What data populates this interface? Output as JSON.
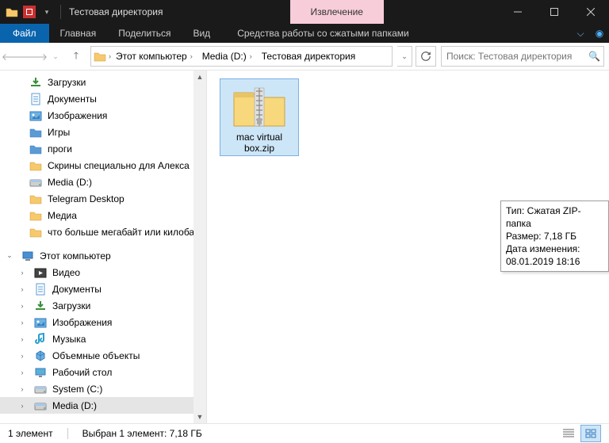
{
  "title": "Тестовая директория",
  "context_tab": "Извлечение",
  "ribbon": {
    "file": "Файл",
    "tabs": [
      "Главная",
      "Поделиться",
      "Вид"
    ],
    "context": "Средства работы со сжатыми папками"
  },
  "breadcrumb": [
    "Этот компьютер",
    "Media (D:)",
    "Тестовая директория"
  ],
  "search_placeholder": "Поиск: Тестовая директория",
  "tree": {
    "group1": [
      {
        "label": "Загрузки",
        "icon": "download"
      },
      {
        "label": "Документы",
        "icon": "doc"
      },
      {
        "label": "Изображения",
        "icon": "images"
      },
      {
        "label": "Игры",
        "icon": "folder-blue"
      },
      {
        "label": "проги",
        "icon": "folder-blue"
      },
      {
        "label": "Скрины специально для Алекса",
        "icon": "folder"
      },
      {
        "label": "Media (D:)",
        "icon": "drive"
      },
      {
        "label": "Telegram Desktop",
        "icon": "folder"
      },
      {
        "label": "Медиа",
        "icon": "folder"
      },
      {
        "label": "что больше мегабайт или килобайт",
        "icon": "folder"
      }
    ],
    "thispc": "Этот компьютер",
    "group2": [
      {
        "label": "Видео",
        "icon": "video"
      },
      {
        "label": "Документы",
        "icon": "doc"
      },
      {
        "label": "Загрузки",
        "icon": "download"
      },
      {
        "label": "Изображения",
        "icon": "images"
      },
      {
        "label": "Музыка",
        "icon": "music"
      },
      {
        "label": "Объемные объекты",
        "icon": "3d"
      },
      {
        "label": "Рабочий стол",
        "icon": "desktop"
      },
      {
        "label": "System (C:)",
        "icon": "drive"
      },
      {
        "label": "Media (D:)",
        "icon": "drive",
        "selected": true
      }
    ]
  },
  "item": {
    "label": "mac virtual box.zip"
  },
  "tooltip": {
    "l1": "Тип: Сжатая ZIP-папка",
    "l2": "Размер: 7,18 ГБ",
    "l3": "Дата изменения: 08.01.2019 18:16"
  },
  "status": {
    "count": "1 элемент",
    "selected": "Выбран 1 элемент: 7,18 ГБ"
  }
}
